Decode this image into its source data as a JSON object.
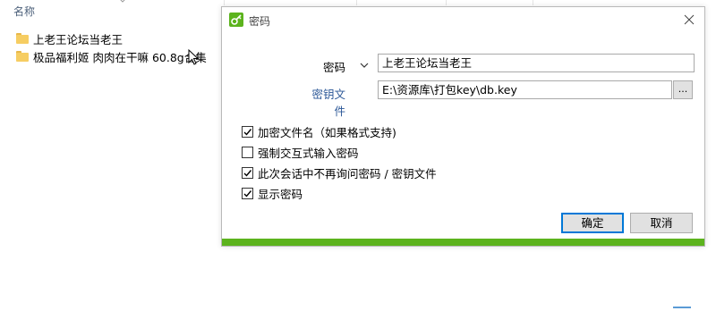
{
  "explorer": {
    "column_name": "名称",
    "files": [
      {
        "name": "上老王论坛当老王"
      },
      {
        "name": "极品福利姬 肉肉在干嘛 60.8g合集"
      }
    ]
  },
  "dialog": {
    "title": "密码",
    "password_label": "密码",
    "password_value": "上老王论坛当老王",
    "keyfile_label": "密钥文件",
    "keyfile_value": "E:\\资源库\\打包key\\db.key",
    "browse_label": "...",
    "options": [
      {
        "label": "加密文件名（如果格式支持)",
        "checked": true
      },
      {
        "label": "强制交互式输入密码",
        "checked": false
      },
      {
        "label": "此次会话中不再询问密码 / 密钥文件",
        "checked": true
      },
      {
        "label": "显示密码",
        "checked": true
      }
    ],
    "ok_label": "确定",
    "cancel_label": "取消"
  },
  "colors": {
    "accent": "#0078d7",
    "progress_green": "#5cb31d",
    "link_blue": "#2b5797",
    "folder_yellow": "#f6cd62"
  }
}
